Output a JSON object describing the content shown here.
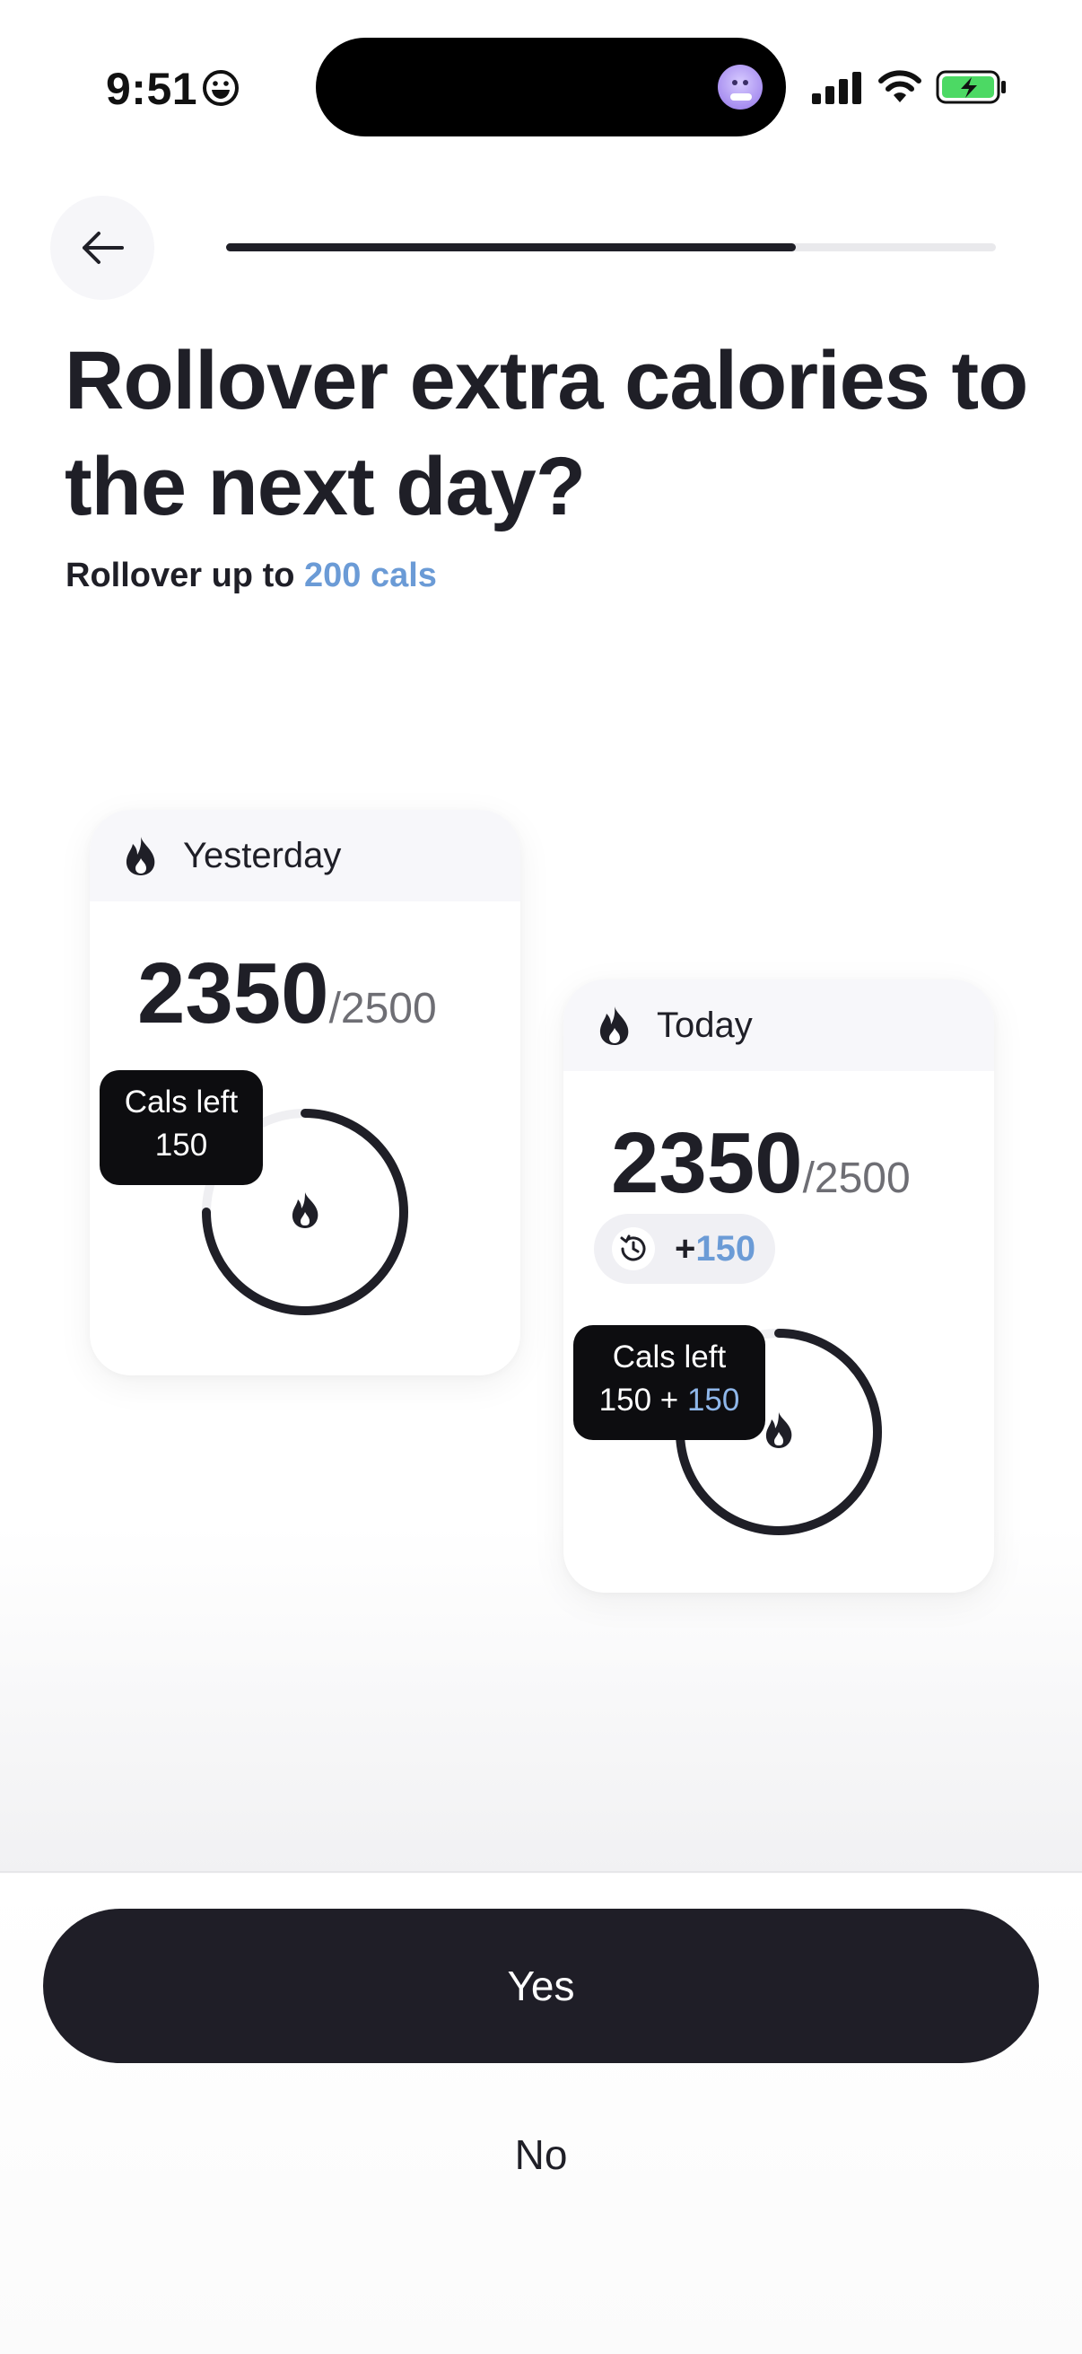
{
  "status_bar": {
    "time": "9:51",
    "emoji_icon": "smiley-face-icon",
    "signal_icon": "cellular-signal-icon",
    "wifi_icon": "wifi-icon",
    "battery_icon": "battery-charging-icon",
    "battery_color": "#4cd964"
  },
  "header": {
    "back_icon": "arrow-left-icon",
    "progress": 0.74
  },
  "title": "Rollover extra calories to the next day?",
  "subtitle": {
    "prefix": "Rollover up to ",
    "highlight": "200 cals"
  },
  "cards": {
    "yesterday": {
      "label": "Yesterday",
      "consumed": "2350",
      "goal": "/2500",
      "tooltip_title": "Cals left",
      "tooltip_value": "150"
    },
    "today": {
      "label": "Today",
      "consumed": "2350",
      "goal": "/2500",
      "rollover_plus": "+",
      "rollover_value": "150",
      "tooltip_title": "Cals left",
      "tooltip_base": "150 + ",
      "tooltip_extra": "150"
    }
  },
  "actions": {
    "yes_label": "Yes",
    "no_label": "No"
  },
  "colors": {
    "accent": "#6b9bd6",
    "dark": "#1f1e27"
  }
}
